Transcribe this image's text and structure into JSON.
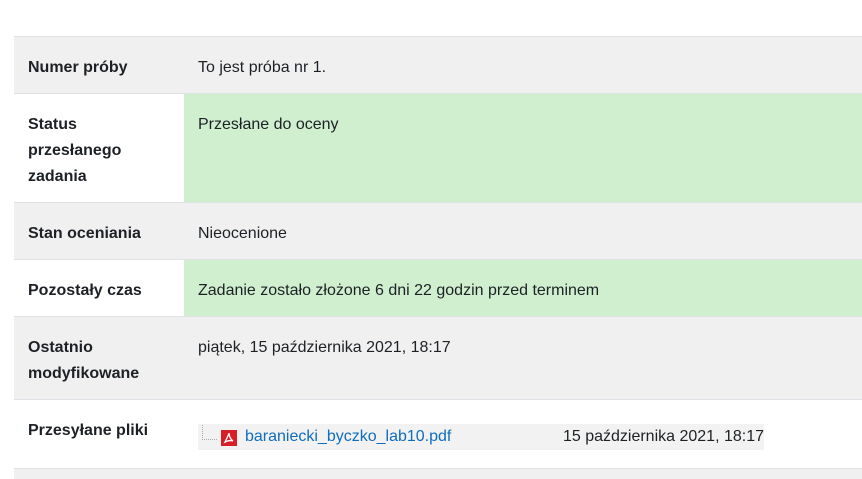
{
  "rows": {
    "attempt": {
      "label": "Numer próby",
      "value": "To jest próba nr 1."
    },
    "submission_status": {
      "label": "Status przesłanego zadania",
      "value": "Przesłane do oceny"
    },
    "grading_status": {
      "label": "Stan oceniania",
      "value": "Nieocenione"
    },
    "time_remaining": {
      "label": "Pozostały czas",
      "value": "Zadanie zostało złożone 6 dni 22 godzin przed terminem"
    },
    "last_modified": {
      "label": "Ostatnio modyfikowane",
      "value": "piątek, 15 października 2021, 18:17"
    },
    "files": {
      "label": "Przesyłane pliki",
      "items": [
        {
          "name": "baraniecki_byczko_lab10.pdf",
          "date": "15 października 2021, 18:17",
          "icon": "pdf-icon"
        }
      ]
    }
  },
  "colors": {
    "success_bg": "#cfefcf",
    "odd_row_bg": "#f0f0f0",
    "link": "#0f6cbf",
    "pdf_red": "#d61f26"
  }
}
